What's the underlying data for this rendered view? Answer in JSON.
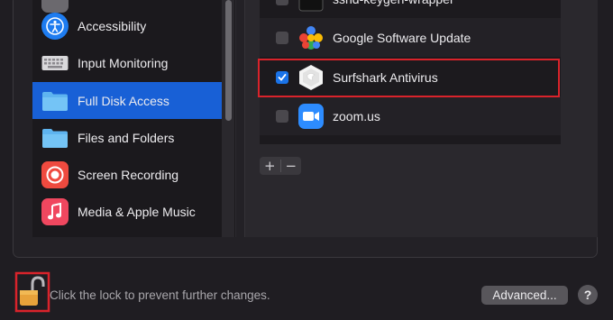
{
  "sidebar": {
    "items": [
      {
        "label": "",
        "icon": "partial-icon"
      },
      {
        "label": "Accessibility",
        "icon": "accessibility-icon"
      },
      {
        "label": "Input Monitoring",
        "icon": "keyboard-icon"
      },
      {
        "label": "Full Disk Access",
        "icon": "folder-icon",
        "selected": true
      },
      {
        "label": "Files and Folders",
        "icon": "folder-icon"
      },
      {
        "label": "Screen Recording",
        "icon": "screen-recording-icon"
      },
      {
        "label": "Media & Apple Music",
        "icon": "music-icon"
      }
    ]
  },
  "apps": {
    "items": [
      {
        "label": "ssnd-keygen-wrapper",
        "checked": false,
        "icon": "terminal-icon"
      },
      {
        "label": "Google Software Update",
        "checked": false,
        "icon": "google-update-icon"
      },
      {
        "label": "Surfshark Antivirus",
        "checked": true,
        "icon": "surfshark-icon"
      },
      {
        "label": "zoom.us",
        "checked": false,
        "icon": "zoom-icon"
      }
    ]
  },
  "controls": {
    "add_label": "+",
    "remove_label": "−"
  },
  "footer": {
    "lock_text": "Click the lock to prevent further changes.",
    "advanced_label": "Advanced...",
    "help_label": "?"
  },
  "colors": {
    "accent": "#1860d6",
    "highlight": "#d9232b",
    "background": "#1f1d22"
  }
}
